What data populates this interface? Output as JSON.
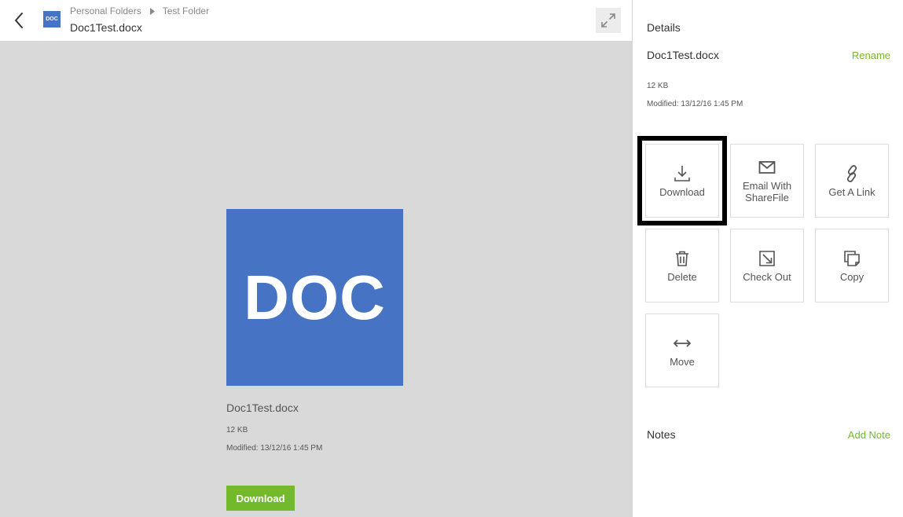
{
  "header": {
    "doc_badge": "DOC",
    "breadcrumb": [
      "Personal Folders",
      "Test Folder"
    ],
    "file_title": "Doc1Test.docx"
  },
  "preview": {
    "tile_label": "DOC",
    "file_name": "Doc1Test.docx",
    "size": "12 KB",
    "modified": "Modified: 13/12/16 1:45 PM",
    "download_label": "Download"
  },
  "details": {
    "heading": "Details",
    "file_name": "Doc1Test.docx",
    "rename_label": "Rename",
    "size": "12 KB",
    "modified": "Modified: 13/12/16 1:45 PM"
  },
  "actions": [
    {
      "label": "Download",
      "icon": "download-icon"
    },
    {
      "label": "Email With\nShareFile",
      "icon": "envelope-icon"
    },
    {
      "label": "Get A Link",
      "icon": "link-icon"
    },
    {
      "label": "Delete",
      "icon": "trash-icon"
    },
    {
      "label": "Check Out",
      "icon": "check-out-icon"
    },
    {
      "label": "Copy",
      "icon": "copy-icon"
    },
    {
      "label": "Move",
      "icon": "move-arrows-icon"
    }
  ],
  "notes": {
    "heading": "Notes",
    "add_label": "Add Note"
  },
  "colors": {
    "accent_green": "#73b92c",
    "doc_blue": "#4673c3",
    "preview_background": "#d9d9d9",
    "highlight_border": "#000000"
  }
}
